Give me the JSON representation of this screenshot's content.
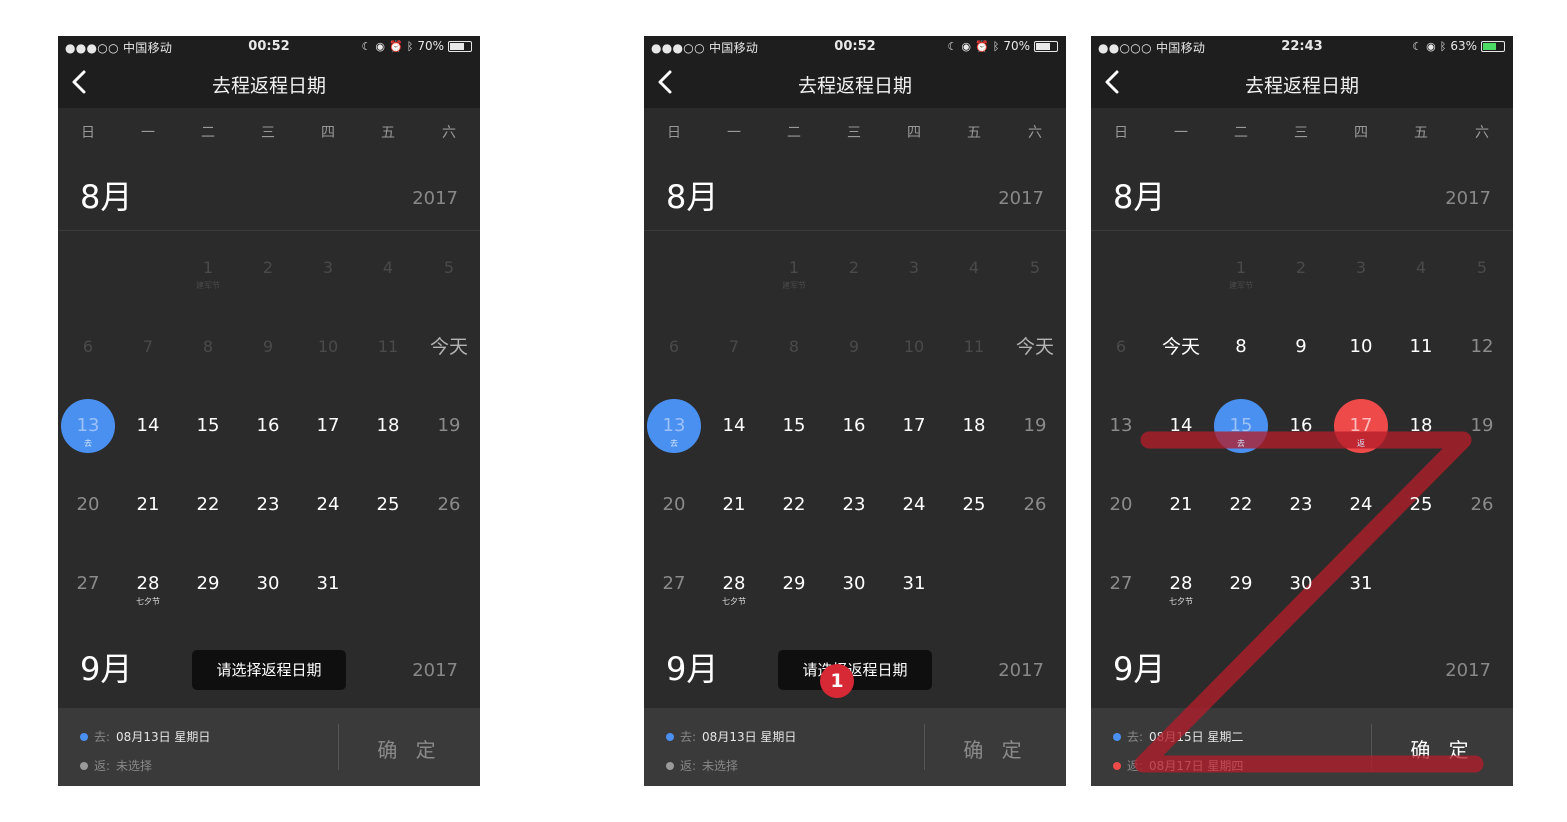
{
  "panels": [
    {
      "status": {
        "carrier": "●●●○○ 中国移动",
        "time": "00:52",
        "battery": "70%"
      },
      "nav_title": "去程返程日期",
      "weekdays": [
        "日",
        "一",
        "二",
        "三",
        "四",
        "五",
        "六"
      ],
      "aug": {
        "label": "8月",
        "year": "2017"
      },
      "sep": {
        "label": "9月",
        "year": "2017"
      },
      "days": [
        {
          "n": "1",
          "sub": "建军节"
        },
        {
          "n": "2"
        },
        {
          "n": "3"
        },
        {
          "n": "4"
        },
        {
          "n": "5"
        },
        {
          "n": "6"
        },
        {
          "n": "7"
        },
        {
          "n": "8"
        },
        {
          "n": "9"
        },
        {
          "n": "10"
        },
        {
          "n": "11"
        },
        {
          "n": "今天"
        },
        {
          "n": "13",
          "sub": "去"
        },
        {
          "n": "14"
        },
        {
          "n": "15"
        },
        {
          "n": "16"
        },
        {
          "n": "17"
        },
        {
          "n": "18"
        },
        {
          "n": "19"
        },
        {
          "n": "20"
        },
        {
          "n": "21"
        },
        {
          "n": "22"
        },
        {
          "n": "23"
        },
        {
          "n": "24"
        },
        {
          "n": "25"
        },
        {
          "n": "26"
        },
        {
          "n": "27"
        },
        {
          "n": "28",
          "sub": "七夕节"
        },
        {
          "n": "29"
        },
        {
          "n": "30"
        },
        {
          "n": "31"
        }
      ],
      "toast": "请选择返程日期",
      "depart": {
        "label": "去:",
        "value": "08月13日 星期日"
      },
      "return": {
        "label": "返:",
        "value": "未选择"
      },
      "confirm": "确 定"
    },
    {
      "status": {
        "carrier": "●●●○○ 中国移动",
        "time": "00:52",
        "battery": "70%"
      },
      "nav_title": "去程返程日期",
      "weekdays": [
        "日",
        "一",
        "二",
        "三",
        "四",
        "五",
        "六"
      ],
      "aug": {
        "label": "8月",
        "year": "2017"
      },
      "sep": {
        "label": "9月",
        "year": "2017"
      },
      "days": [
        {
          "n": "1",
          "sub": "建军节"
        },
        {
          "n": "2"
        },
        {
          "n": "3"
        },
        {
          "n": "4"
        },
        {
          "n": "5"
        },
        {
          "n": "6"
        },
        {
          "n": "7"
        },
        {
          "n": "8"
        },
        {
          "n": "9"
        },
        {
          "n": "10"
        },
        {
          "n": "11"
        },
        {
          "n": "今天"
        },
        {
          "n": "13",
          "sub": "去"
        },
        {
          "n": "14"
        },
        {
          "n": "15"
        },
        {
          "n": "16"
        },
        {
          "n": "17"
        },
        {
          "n": "18"
        },
        {
          "n": "19"
        },
        {
          "n": "20"
        },
        {
          "n": "21"
        },
        {
          "n": "22"
        },
        {
          "n": "23"
        },
        {
          "n": "24"
        },
        {
          "n": "25"
        },
        {
          "n": "26"
        },
        {
          "n": "27"
        },
        {
          "n": "28",
          "sub": "七夕节"
        },
        {
          "n": "29"
        },
        {
          "n": "30"
        },
        {
          "n": "31"
        }
      ],
      "toast": "请选择返程日期",
      "badge": "1",
      "depart": {
        "label": "去:",
        "value": "08月13日 星期日"
      },
      "return": {
        "label": "返:",
        "value": "未选择"
      },
      "confirm": "确 定"
    },
    {
      "status": {
        "carrier": "●●○○○ 中国移动",
        "time": "22:43",
        "battery": "63%"
      },
      "nav_title": "去程返程日期",
      "weekdays": [
        "日",
        "一",
        "二",
        "三",
        "四",
        "五",
        "六"
      ],
      "aug": {
        "label": "8月",
        "year": "2017"
      },
      "sep": {
        "label": "9月",
        "year": "2017"
      },
      "days": [
        {
          "n": "1",
          "sub": "建军节"
        },
        {
          "n": "2"
        },
        {
          "n": "3"
        },
        {
          "n": "4"
        },
        {
          "n": "5"
        },
        {
          "n": "6"
        },
        {
          "n": "今天"
        },
        {
          "n": "8"
        },
        {
          "n": "9"
        },
        {
          "n": "10"
        },
        {
          "n": "11"
        },
        {
          "n": "12"
        },
        {
          "n": "13"
        },
        {
          "n": "14"
        },
        {
          "n": "15",
          "sub": "去"
        },
        {
          "n": "16"
        },
        {
          "n": "17",
          "sub": "返"
        },
        {
          "n": "18"
        },
        {
          "n": "19"
        },
        {
          "n": "20"
        },
        {
          "n": "21"
        },
        {
          "n": "22"
        },
        {
          "n": "23"
        },
        {
          "n": "24"
        },
        {
          "n": "25"
        },
        {
          "n": "26"
        },
        {
          "n": "27"
        },
        {
          "n": "28",
          "sub": "七夕节"
        },
        {
          "n": "29"
        },
        {
          "n": "30"
        },
        {
          "n": "31"
        }
      ],
      "depart": {
        "label": "去:",
        "value": "08月15日 星期二"
      },
      "return": {
        "label": "返:",
        "value": "08月17日 星期四"
      },
      "confirm": "确 定"
    }
  ],
  "colors": {
    "accent_blue": "#4a90f0",
    "accent_red": "#ef4a4a",
    "annotation_red": "#b21e2a"
  }
}
